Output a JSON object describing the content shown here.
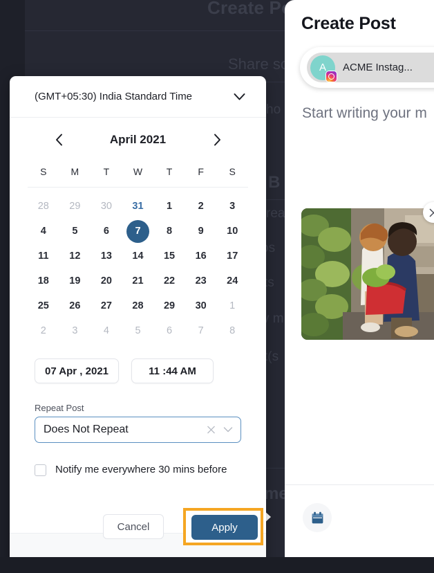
{
  "background": {
    "title": "Create Po",
    "subtitle": "Share so",
    "fragments": [
      "ho",
      "B",
      "rea",
      "os",
      "ts",
      "v m",
      "t(s",
      "me"
    ]
  },
  "right_panel": {
    "title": "Create Post",
    "account": {
      "avatar_initial": "A",
      "name": "ACME Instag...",
      "network_icon": "instagram-icon",
      "avatar_color": "#7fd4cc"
    },
    "composer_placeholder": "Start writing your m",
    "media": {
      "alt": "Two shoppers selecting produce in a grocery store",
      "close_icon": "close-icon"
    },
    "schedule_icon": "calendar-icon"
  },
  "dialog": {
    "timezone": {
      "value": "(GMT+05:30) India Standard Time",
      "chevron_icon": "chevron-down-icon"
    },
    "calendar": {
      "month_label": "April 2021",
      "prev_icon": "chevron-left-icon",
      "next_icon": "chevron-right-icon",
      "weekdays": [
        "S",
        "M",
        "T",
        "W",
        "T",
        "F",
        "S"
      ],
      "weeks": [
        [
          {
            "d": "28",
            "state": "muted"
          },
          {
            "d": "29",
            "state": "muted"
          },
          {
            "d": "30",
            "state": "muted"
          },
          {
            "d": "31",
            "state": "today"
          },
          {
            "d": "1",
            "state": "normal"
          },
          {
            "d": "2",
            "state": "normal"
          },
          {
            "d": "3",
            "state": "normal"
          }
        ],
        [
          {
            "d": "4",
            "state": "normal"
          },
          {
            "d": "5",
            "state": "normal"
          },
          {
            "d": "6",
            "state": "normal"
          },
          {
            "d": "7",
            "state": "selected"
          },
          {
            "d": "8",
            "state": "normal"
          },
          {
            "d": "9",
            "state": "normal"
          },
          {
            "d": "10",
            "state": "normal"
          }
        ],
        [
          {
            "d": "11",
            "state": "normal"
          },
          {
            "d": "12",
            "state": "normal"
          },
          {
            "d": "13",
            "state": "normal"
          },
          {
            "d": "14",
            "state": "normal"
          },
          {
            "d": "15",
            "state": "normal"
          },
          {
            "d": "16",
            "state": "normal"
          },
          {
            "d": "17",
            "state": "normal"
          }
        ],
        [
          {
            "d": "18",
            "state": "normal"
          },
          {
            "d": "19",
            "state": "normal"
          },
          {
            "d": "20",
            "state": "normal"
          },
          {
            "d": "21",
            "state": "normal"
          },
          {
            "d": "22",
            "state": "normal"
          },
          {
            "d": "23",
            "state": "normal"
          },
          {
            "d": "24",
            "state": "normal"
          }
        ],
        [
          {
            "d": "25",
            "state": "normal"
          },
          {
            "d": "26",
            "state": "normal"
          },
          {
            "d": "27",
            "state": "normal"
          },
          {
            "d": "28",
            "state": "normal"
          },
          {
            "d": "29",
            "state": "normal"
          },
          {
            "d": "30",
            "state": "normal"
          },
          {
            "d": "1",
            "state": "muted"
          }
        ],
        [
          {
            "d": "2",
            "state": "muted"
          },
          {
            "d": "3",
            "state": "muted"
          },
          {
            "d": "4",
            "state": "muted"
          },
          {
            "d": "5",
            "state": "muted"
          },
          {
            "d": "6",
            "state": "muted"
          },
          {
            "d": "7",
            "state": "muted"
          },
          {
            "d": "8",
            "state": "muted"
          }
        ]
      ]
    },
    "date_value": "07 Apr , 2021",
    "time_value": "11 :44 AM",
    "repeat": {
      "label": "Repeat Post",
      "value": "Does Not Repeat",
      "clear_icon": "close-icon",
      "chevron_icon": "chevron-down-icon"
    },
    "notify": {
      "label": "Notify me everywhere 30 mins before",
      "checked": false
    },
    "buttons": {
      "cancel": "Cancel",
      "apply": "Apply"
    },
    "highlight_color": "#f5a623",
    "accent_color": "#2d5f8b"
  }
}
